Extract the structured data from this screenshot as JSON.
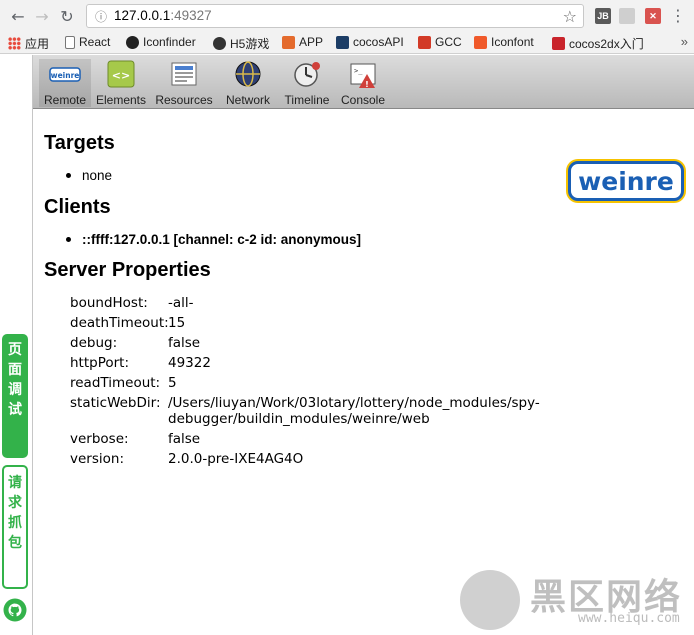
{
  "browser": {
    "url_host": "127.0.0.1",
    "url_port": ":49327",
    "back_icon": "arrow-left",
    "forward_icon": "arrow-right",
    "reload_icon": "reload",
    "info_icon": "info-circle",
    "star_icon": "star",
    "menu_icon": "vertical-dots",
    "extensions": [
      {
        "name": "JB",
        "color": "#5a5a5a"
      },
      {
        "name": "",
        "color": "#c9c9c9"
      },
      {
        "name": "✕",
        "color": "#d9534f"
      }
    ]
  },
  "bookmarks": {
    "items": [
      {
        "label": "应用",
        "icon": "apps-grid-icon",
        "color": "#e84a3c"
      },
      {
        "label": "React",
        "icon": "page-icon",
        "color": "#ffffff"
      },
      {
        "label": "Iconfinder",
        "icon": "iconfinder-icon",
        "color": "#222222"
      },
      {
        "label": "H5游戏",
        "icon": "h5-icon",
        "color": "#333333"
      },
      {
        "label": "APP",
        "icon": "app-icon",
        "color": "#e46b2d"
      },
      {
        "label": "cocosAPI",
        "icon": "cocos-icon",
        "color": "#1c3d66"
      },
      {
        "label": "GCC",
        "icon": "gcc-icon",
        "color": "#d23a27"
      },
      {
        "label": "Iconfont",
        "icon": "iconfont-icon",
        "color": "#f0592a"
      },
      {
        "label": "cocos2dx入门",
        "icon": "csdn-icon",
        "color": "#c9242b"
      }
    ],
    "more": "»"
  },
  "sidebar": {
    "debug_label": "页面调试",
    "capture_label": "请求抓包",
    "github_icon": "github-icon"
  },
  "toolbar": {
    "tools": [
      {
        "label": "Remote",
        "icon": "weinre-icon",
        "active": true
      },
      {
        "label": "Elements",
        "icon": "elements-icon"
      },
      {
        "label": "Resources",
        "icon": "resources-icon"
      },
      {
        "label": "Network",
        "icon": "network-icon"
      },
      {
        "label": "Timeline",
        "icon": "timeline-icon"
      },
      {
        "label": "Console",
        "icon": "console-icon"
      }
    ]
  },
  "remote": {
    "targets_heading": "Targets",
    "targets": [
      "none"
    ],
    "clients_heading": "Clients",
    "clients": [
      "::ffff:127.0.0.1 [channel: c-2 id: anonymous]"
    ],
    "server_heading": "Server Properties",
    "logo_text": "weinre",
    "properties": [
      {
        "key": "boundHost:",
        "value": "-all-"
      },
      {
        "key": "deathTimeout:",
        "value": "15"
      },
      {
        "key": "debug:",
        "value": "false"
      },
      {
        "key": "httpPort:",
        "value": "49322"
      },
      {
        "key": "readTimeout:",
        "value": "5"
      },
      {
        "key": "staticWebDir:",
        "value": "/Users/liuyan/Work/03lotary/lottery/node_modules/spy-debugger/buildin_modules/weinre/web"
      },
      {
        "key": "verbose:",
        "value": "false"
      },
      {
        "key": "version:",
        "value": "2.0.0-pre-IXE4AG4O"
      }
    ]
  },
  "watermark": {
    "title": "黑区网络",
    "sub": "www.heiqu.com"
  }
}
